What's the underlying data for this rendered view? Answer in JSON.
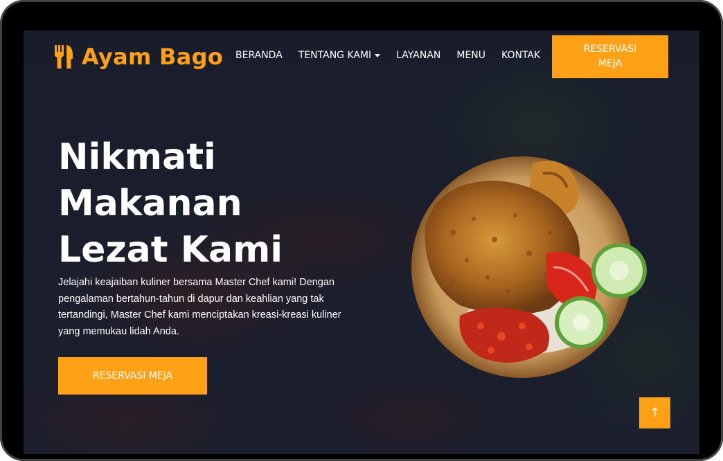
{
  "brand": {
    "name": "Ayam Bago",
    "icon": "utensils-icon",
    "accent_color": "#FEA116"
  },
  "nav": {
    "items": [
      {
        "label": "BERANDA",
        "has_dropdown": false
      },
      {
        "label": "TENTANG KAMI",
        "has_dropdown": true
      },
      {
        "label": "LAYANAN",
        "has_dropdown": false
      },
      {
        "label": "MENU",
        "has_dropdown": false
      },
      {
        "label": "KONTAK",
        "has_dropdown": false
      }
    ],
    "cta_line1": "RESERVASI",
    "cta_line2": "MEJA"
  },
  "hero": {
    "title_lines": [
      "Nikmati",
      "Makanan",
      "Lezat Kami"
    ],
    "description": "Jelajahi keajaiban kuliner bersama Master Chef kami! Dengan pengalaman bertahun-tahun di dapur dan keahlian yang tak tertandingi, Master Chef kami menciptakan kreasi-kreasi kuliner yang memukau lidah Anda.",
    "button_label": "RESERVASI MEJA",
    "image": "fried-chicken-plate-image"
  },
  "back_to_top": {
    "icon": "arrow-up-icon",
    "glyph": "↑"
  }
}
